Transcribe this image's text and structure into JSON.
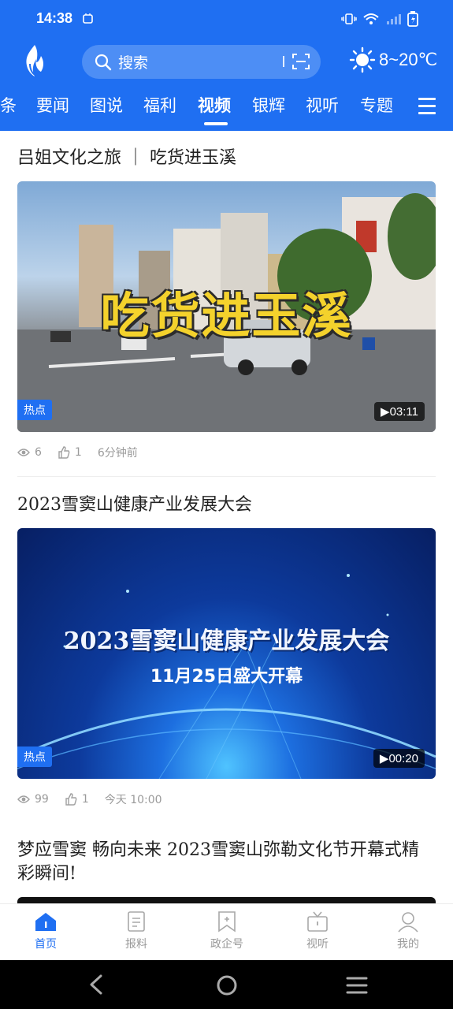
{
  "status": {
    "time": "14:38"
  },
  "search": {
    "placeholder": "搜索"
  },
  "weather": {
    "temp": "8~20℃"
  },
  "tabs": [
    {
      "label": "条"
    },
    {
      "label": "要闻"
    },
    {
      "label": "图说"
    },
    {
      "label": "福利"
    },
    {
      "label": "视频"
    },
    {
      "label": "银辉"
    },
    {
      "label": "视听"
    },
    {
      "label": "专题"
    }
  ],
  "active_tab": "视频",
  "feed": [
    {
      "title": "吕姐文化之旅 ｜ 吃货进玉溪",
      "thumb_text": "吃货进玉溪",
      "badge": "热点",
      "duration": "03:11",
      "views": "6",
      "likes": "1",
      "time": "6分钟前"
    },
    {
      "title": "2023雪窦山健康产业发展大会",
      "thumb_text": "2023雪窦山健康产业发展大会",
      "thumb_subtext": "11月25日盛大开幕",
      "badge": "热点",
      "duration": "00:20",
      "views": "99",
      "likes": "1",
      "time": "今天 10:00"
    },
    {
      "title": "梦应雪窦 畅向未来 2023雪窦山弥勒文化节开幕式精彩瞬间!"
    }
  ],
  "bottom_nav": [
    {
      "label": "首页",
      "icon": "home-icon"
    },
    {
      "label": "报料",
      "icon": "report-icon"
    },
    {
      "label": "政企号",
      "icon": "bookmark-icon"
    },
    {
      "label": "视听",
      "icon": "tv-icon"
    },
    {
      "label": "我的",
      "icon": "profile-icon"
    }
  ],
  "colors": {
    "brand": "#1f6ff2",
    "muted": "#9a9a9a"
  }
}
